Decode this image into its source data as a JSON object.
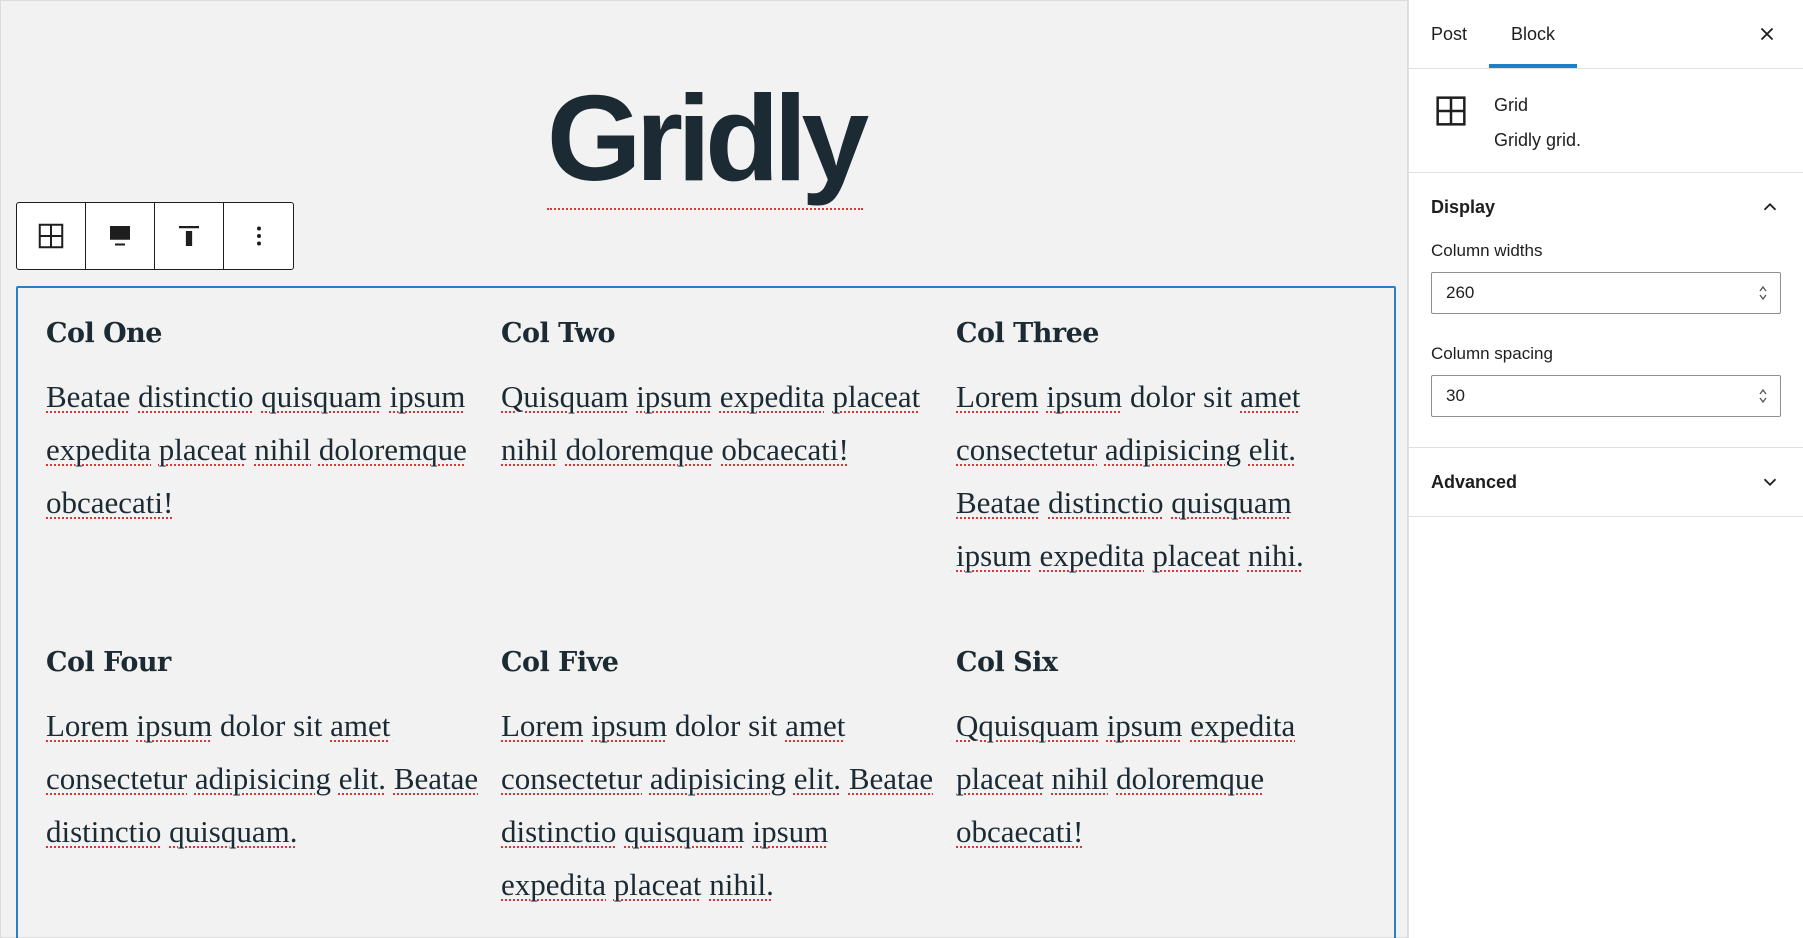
{
  "editor": {
    "site_title": "Gridly",
    "toolbar": {
      "buttons": [
        {
          "icon": "grid-icon"
        },
        {
          "icon": "align-icon"
        },
        {
          "icon": "vertical-align-top-icon"
        },
        {
          "icon": "more-options-icon"
        }
      ]
    },
    "grid": {
      "columns": [
        {
          "heading": "Col One",
          "text": "Beatae distinctio quisquam ipsum expedita placeat nihil doloremque obcaecati!"
        },
        {
          "heading": "Col Two",
          "text": "Quisquam ipsum expedita placeat nihil doloremque obcaecati!"
        },
        {
          "heading": "Col Three",
          "text": "Lorem ipsum dolor sit amet consectetur adipisicing elit. Beatae distinctio quisquam ipsum expedita placeat nihi."
        },
        {
          "heading": "Col Four",
          "text": "Lorem ipsum dolor sit amet consectetur adipisicing elit. Beatae distinctio quisquam."
        },
        {
          "heading": "Col Five",
          "text": "Lorem ipsum dolor sit amet consectetur adipisicing elit. Beatae distinctio quisquam ipsum expedita placeat nihil."
        },
        {
          "heading": "Col Six",
          "text": "Qquisquam ipsum expedita placeat nihil doloremque obcaecati!"
        }
      ]
    }
  },
  "sidebar": {
    "tabs": [
      {
        "label": "Post",
        "active": false
      },
      {
        "label": "Block",
        "active": true
      }
    ],
    "block": {
      "name": "Grid",
      "description": "Gridly grid.",
      "icon": "grid-icon"
    },
    "display_panel": {
      "title": "Display",
      "expanded": true,
      "column_widths": {
        "label": "Column widths",
        "value": "260"
      },
      "column_spacing": {
        "label": "Column spacing",
        "value": "30"
      }
    },
    "advanced_panel": {
      "title": "Advanced",
      "expanded": false
    }
  },
  "colors": {
    "accent": "#1e80c6",
    "selection_border": "#2b7ec1",
    "spellcheck": "#d63638",
    "text_dark": "#1b2a33",
    "canvas_bg": "#f1f2f1"
  }
}
